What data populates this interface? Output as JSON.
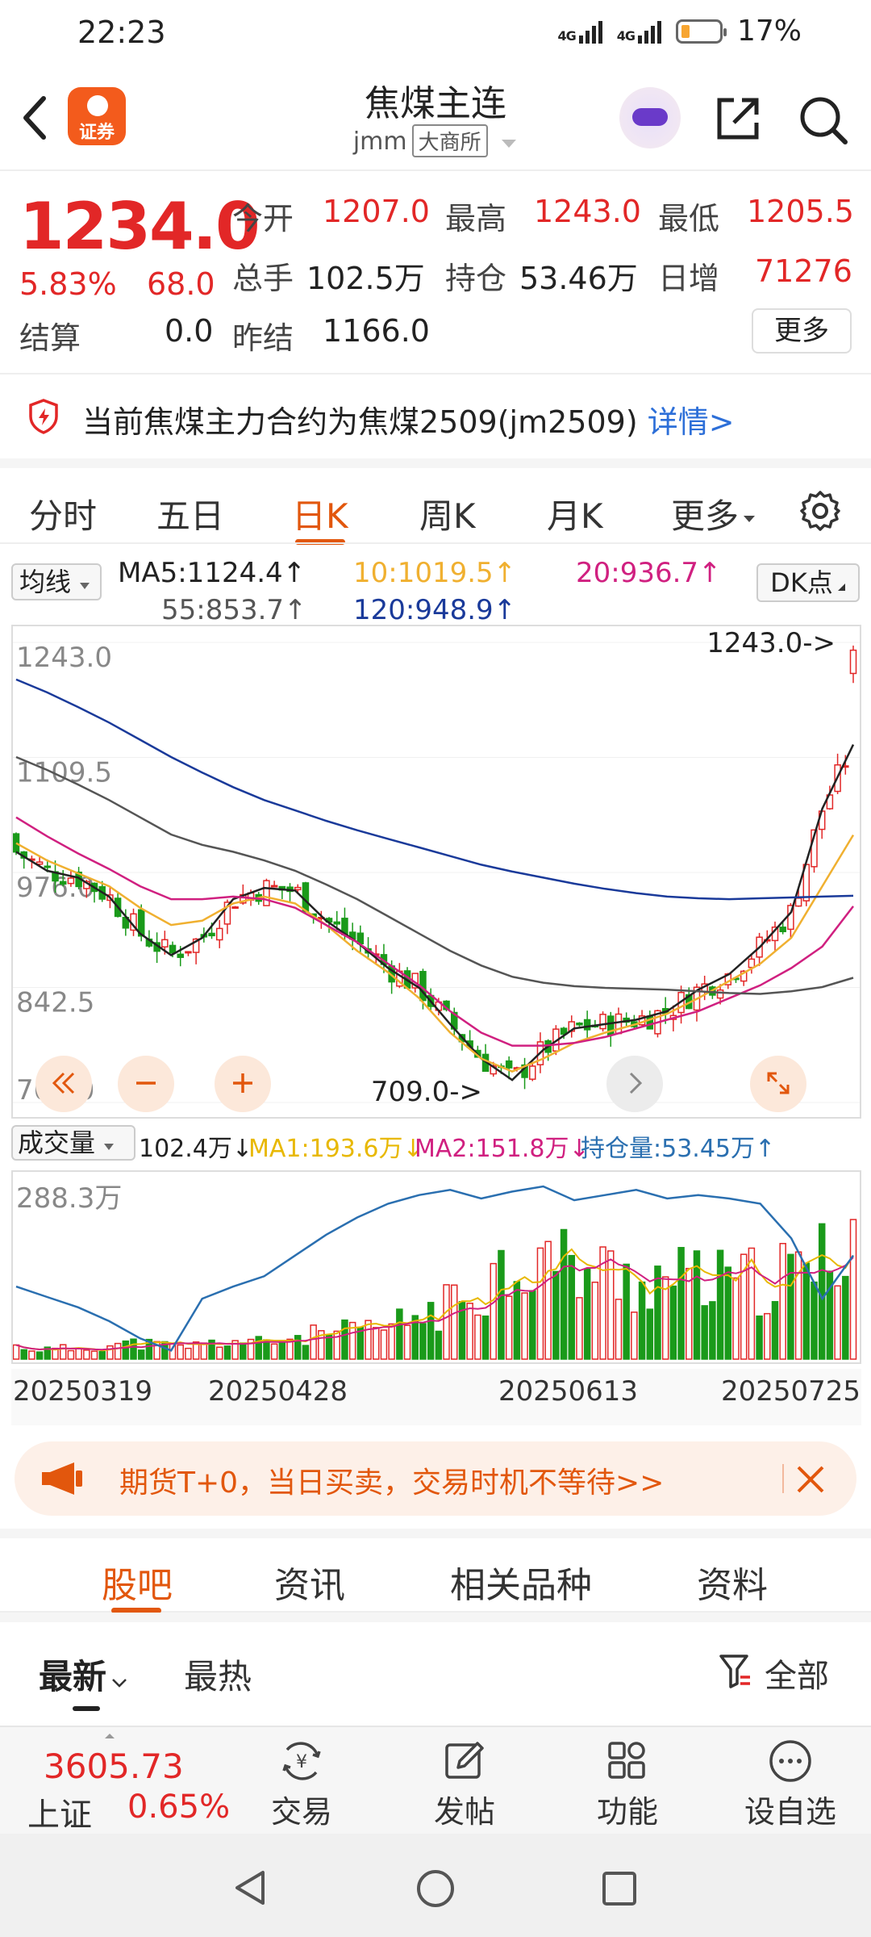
{
  "status": {
    "time": "22:23",
    "net1": "4G",
    "net2": "4G",
    "battery": "17%"
  },
  "header": {
    "brand_label": "证券",
    "title": "焦煤主连",
    "code": "jmm",
    "exchange": "大商所"
  },
  "quote": {
    "price": "1234.0",
    "change_pct": "5.83%",
    "change_val": "68.0",
    "open_label": "今开",
    "open": "1207.0",
    "high_label": "最高",
    "high": "1243.0",
    "low_label": "最低",
    "low": "1205.5",
    "volume_label": "总手",
    "volume": "102.5万",
    "oi_label": "持仓",
    "oi": "53.46万",
    "daily_inc_label": "日增",
    "daily_inc": "71276",
    "settle_label": "结算",
    "settle": "0.0",
    "prev_settle_label": "昨结",
    "prev_settle": "1166.0",
    "more_button": "更多"
  },
  "notice": {
    "text": "当前焦煤主力合约为焦煤2509(jm2509)",
    "link": "详情>"
  },
  "tabs": [
    "分时",
    "五日",
    "日K",
    "周K",
    "月K",
    "更多"
  ],
  "active_tab": "日K",
  "ma": {
    "selector": "均线",
    "ma5": "MA5:1124.4↑",
    "ma10": "10:1019.5↑",
    "ma20": "20:936.7↑",
    "ma55": "55:853.7↑",
    "ma120": "120:948.9↑",
    "dk_button": "DK点"
  },
  "colors": {
    "up": "#e22727",
    "down": "#1a9a1a",
    "ma5": "#222222",
    "ma10": "#f0b030",
    "ma20": "#d02080",
    "ma55": "#555555",
    "ma120": "#1a3a9a",
    "accent": "#e2570d"
  },
  "chart_data": [
    {
      "type": "candlestick",
      "yticks": [
        "1243.0",
        "1109.5",
        "976.0",
        "842.5",
        "709.0"
      ],
      "ylim": [
        709.0,
        1243.0
      ],
      "max_label": "1243.0->",
      "min_label": "709.0->",
      "series": [
        {
          "name": "MA5",
          "values": [
            1000,
            978,
            970,
            948,
            905,
            880,
            900,
            945,
            958,
            955,
            920,
            895,
            865,
            842,
            800,
            760,
            735,
            770,
            795,
            800,
            805,
            815,
            840,
            858,
            890,
            930,
            1050,
            1124.4
          ]
        },
        {
          "name": "MA10",
          "values": [
            1010,
            990,
            975,
            960,
            935,
            915,
            920,
            940,
            948,
            940,
            915,
            885,
            860,
            830,
            790,
            760,
            745,
            760,
            778,
            790,
            800,
            812,
            830,
            850,
            870,
            900,
            960,
            1019.5
          ]
        },
        {
          "name": "MA20",
          "values": [
            1040,
            1018,
            998,
            980,
            960,
            945,
            945,
            948,
            945,
            935,
            915,
            895,
            870,
            845,
            815,
            790,
            775,
            775,
            778,
            785,
            795,
            805,
            815,
            830,
            845,
            865,
            890,
            936.7
          ]
        },
        {
          "name": "MA55",
          "values": [
            1110,
            1095,
            1078,
            1060,
            1040,
            1020,
            1008,
            1000,
            990,
            978,
            962,
            945,
            925,
            905,
            885,
            868,
            855,
            848,
            844,
            842,
            841,
            840,
            838,
            836,
            835,
            838,
            843,
            853.7
          ]
        },
        {
          "name": "MA120",
          "values": [
            1200,
            1185,
            1168,
            1150,
            1130,
            1110,
            1092,
            1075,
            1060,
            1048,
            1036,
            1025,
            1015,
            1005,
            995,
            985,
            977,
            970,
            963,
            957,
            952,
            948,
            946,
            945,
            946,
            947,
            948,
            948.9
          ]
        }
      ]
    },
    {
      "type": "bar",
      "legend": {
        "selector": "成交量",
        "vol": "102.4万↓",
        "ma1": "MA1:193.6万↓",
        "ma2": "MA2:151.8万↓",
        "oi": "持仓量:53.45万↑"
      },
      "ytick": "288.3万",
      "x_labels": [
        "20250319",
        "20250428",
        "20250613",
        "20250725"
      ]
    }
  ],
  "promo": {
    "text": "期货T+0，当日买卖，交易时机不等待>>"
  },
  "content_tabs": [
    "股吧",
    "资讯",
    "相关品种",
    "资料"
  ],
  "sort": {
    "latest": "最新",
    "hot": "最热",
    "all": "全部"
  },
  "index": {
    "value": "3605.73",
    "name": "上证",
    "pct": "0.65%"
  },
  "bottom_nav": [
    "交易",
    "发帖",
    "功能",
    "设自选"
  ]
}
